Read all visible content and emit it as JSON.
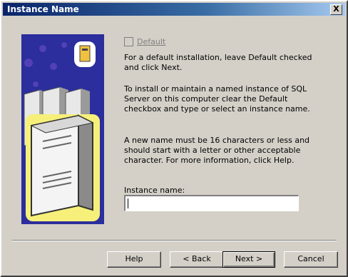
{
  "window": {
    "title": "Instance Name",
    "close_label": "X"
  },
  "checkbox": {
    "label": "Default",
    "checked": false,
    "enabled": false
  },
  "text": {
    "para1": "For a default installation, leave Default checked and click Next.",
    "para2": "To install or maintain a named instance of SQL Server on this computer clear the Default checkbox and type or select an instance name.",
    "para3": "A new name must be 16 characters or less and should start with a letter or other acceptable character.  For more information, click Help."
  },
  "instance": {
    "label": "Instance name:",
    "value": ""
  },
  "buttons": {
    "help": "Help",
    "back": "< Back",
    "next": "Next >",
    "cancel": "Cancel"
  },
  "icons": {
    "close": "close-icon",
    "art": "sql-server-illustration"
  },
  "colors": {
    "titlebar_start": "#0a246a",
    "art_bg": "#2b2e9c",
    "dialog_bg": "#d4d0c8"
  }
}
